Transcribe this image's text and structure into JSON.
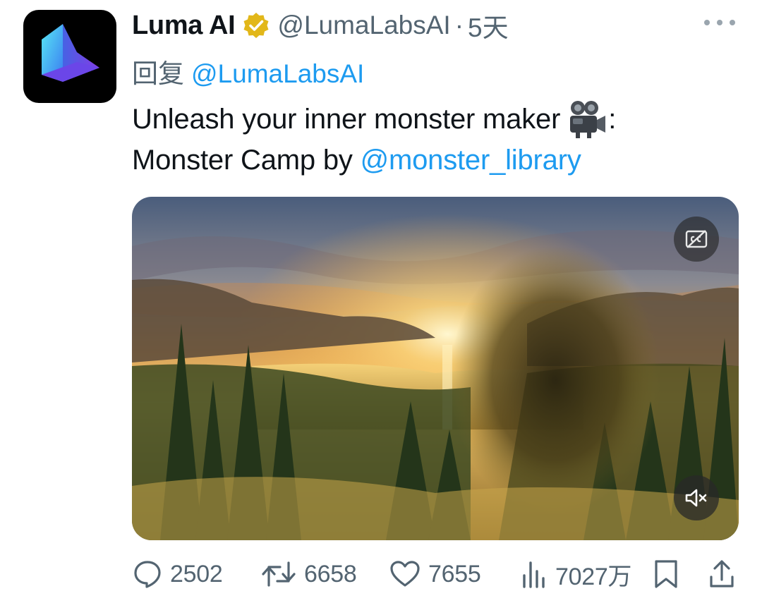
{
  "tweet": {
    "display_name": "Luma AI",
    "handle": "@LumaLabsAI",
    "separator": "·",
    "time": "5天",
    "reply_prefix": "回复",
    "reply_to": "@LumaLabsAI",
    "text_line1": "Unleash your inner monster maker",
    "text_line1_suffix": ":",
    "text_line2_prefix": "Monster Camp by ",
    "text_line2_mention": "@monster_library"
  },
  "media": {
    "cc_icon": "closed-captions-off-icon",
    "mute_icon": "muted-speaker-icon"
  },
  "actions": {
    "replies": "2502",
    "retweets": "6658",
    "likes": "7655",
    "views": "7027万"
  },
  "colors": {
    "link": "#1d9bf0",
    "secondary_text": "#536471",
    "verified_badge": "#e2b719"
  }
}
